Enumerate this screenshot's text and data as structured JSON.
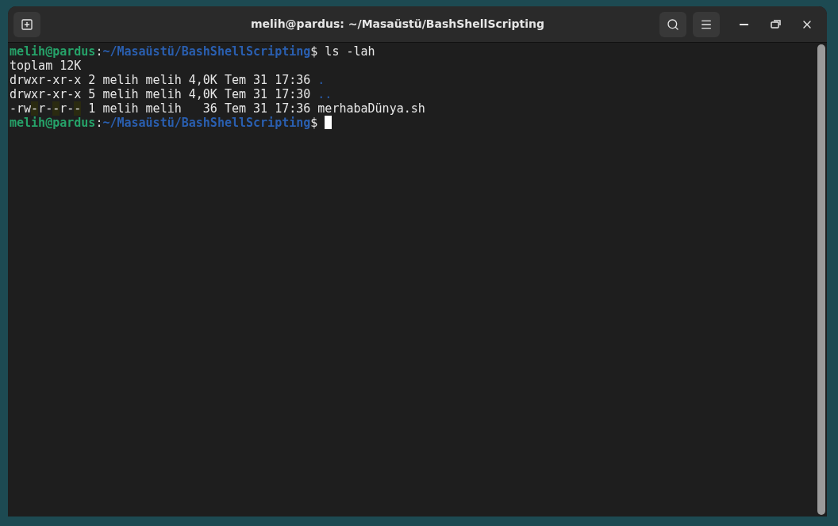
{
  "window": {
    "title": "melih@pardus: ~/Masaüstü/BashShellScripting"
  },
  "terminal": {
    "lines": [
      {
        "cursor": false,
        "segments": [
          {
            "kind": "user",
            "text": "melih@pardus"
          },
          {
            "kind": "plain",
            "text": ":"
          },
          {
            "kind": "path",
            "text": "~/Masaüstü/BashShellScripting"
          },
          {
            "kind": "plain",
            "text": "$ ls -lah"
          }
        ]
      },
      {
        "cursor": false,
        "segments": [
          {
            "kind": "plain",
            "text": "toplam 12K"
          }
        ]
      },
      {
        "cursor": false,
        "segments": [
          {
            "kind": "plain",
            "text": "drwxr-xr-x 2 melih melih 4,0K Tem 31 17:36 "
          },
          {
            "kind": "dir",
            "text": "."
          }
        ]
      },
      {
        "cursor": false,
        "segments": [
          {
            "kind": "plain",
            "text": "drwxr-xr-x 5 melih melih 4,0K Tem 31 17:30 "
          },
          {
            "kind": "dir",
            "text": ".."
          }
        ]
      },
      {
        "cursor": false,
        "segments": [
          {
            "kind": "plain",
            "text": "-rw"
          },
          {
            "kind": "highlight",
            "text": "-"
          },
          {
            "kind": "plain",
            "text": "r-"
          },
          {
            "kind": "highlight",
            "text": "-"
          },
          {
            "kind": "plain",
            "text": "r-"
          },
          {
            "kind": "highlight",
            "text": "-"
          },
          {
            "kind": "plain",
            "text": " 1 melih melih   36 Tem 31 17:36 merhabaDünya.sh"
          }
        ]
      },
      {
        "cursor": true,
        "segments": [
          {
            "kind": "user",
            "text": "melih@pardus"
          },
          {
            "kind": "plain",
            "text": ":"
          },
          {
            "kind": "path",
            "text": "~/Masaüstü/BashShellScripting"
          },
          {
            "kind": "plain",
            "text": "$ "
          }
        ]
      }
    ]
  }
}
